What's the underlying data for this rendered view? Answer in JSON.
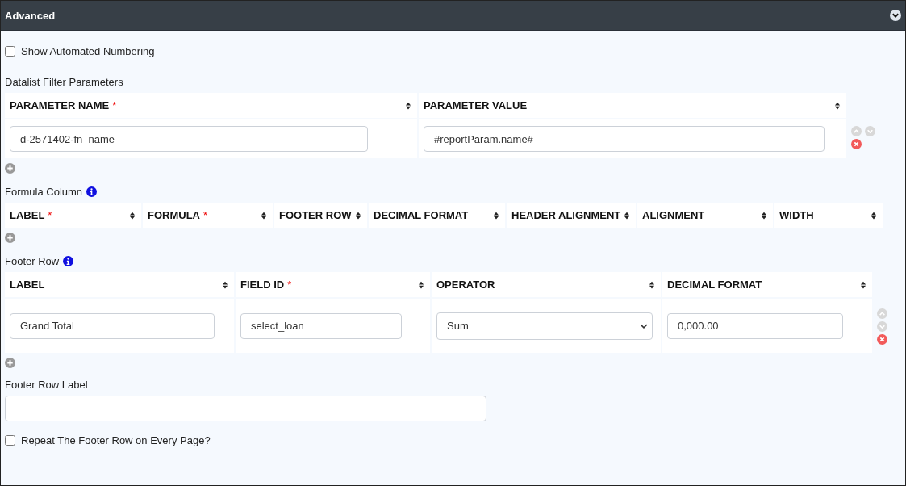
{
  "panel": {
    "title": "Advanced",
    "expanded": true
  },
  "items": [
    {
      "kind": "checkbox",
      "label": "Show Automated Numbering",
      "checked": false
    },
    {
      "kind": "grid",
      "label": "Datalist Filter Parameters",
      "columns": [
        {
          "label": "PARAMETER NAME",
          "mark": "*"
        },
        {
          "label": "PARAMETER VALUE"
        }
      ],
      "rows": [
        {
          "cells": [
            {
              "kind": "text",
              "value": "d-2571402-fn_name"
            },
            {
              "kind": "text",
              "value": "#reportParam.name#"
            }
          ]
        }
      ]
    },
    {
      "kind": "grid",
      "label": "Formula Column",
      "info": true,
      "columns": [
        {
          "label": "LABEL",
          "mark": "*"
        },
        {
          "label": "FORMULA",
          "mark": "*"
        },
        {
          "label": "FOOTER ROW"
        },
        {
          "label": "DECIMAL FORMAT"
        },
        {
          "label": "HEADER ALIGNMENT"
        },
        {
          "label": "ALIGNMENT"
        },
        {
          "label": "WIDTH"
        }
      ]
    },
    {
      "kind": "grid",
      "label": "Footer Row",
      "info": true,
      "columns": [
        {
          "label": "LABEL"
        },
        {
          "label": "FIELD ID",
          "mark": "*"
        },
        {
          "label": "OPERATOR"
        },
        {
          "label": "DECIMAL FORMAT"
        }
      ],
      "rows": [
        {
          "cells": [
            {
              "kind": "text",
              "value": "Grand Total"
            },
            {
              "kind": "text",
              "value": "select_loan"
            },
            {
              "kind": "select",
              "value": "Sum"
            },
            {
              "kind": "text",
              "value": "0,000.00"
            }
          ]
        }
      ]
    },
    {
      "kind": "textfield",
      "label": "Footer Row Label"
    },
    {
      "kind": "checkbox",
      "label": "Repeat The Footer Row on Every Page?",
      "checked": false
    }
  ]
}
